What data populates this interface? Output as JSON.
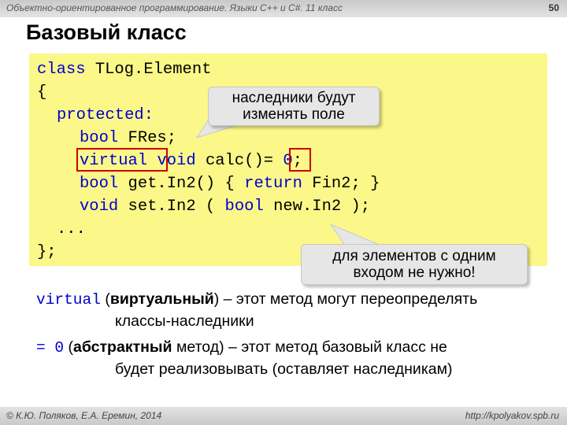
{
  "header": {
    "course_title": "Объектно-ориентированное программирование. Языки C++ и C#. 11 класс",
    "page_number": "50"
  },
  "slide": {
    "title": "Базовый класс"
  },
  "code": {
    "line1_kw": "class",
    "line1_rest": " TLog.Element",
    "line2": "{",
    "line3_kw": "protected:",
    "line4_kw": "bool",
    "line4_rest": " FRes;",
    "line5_kw1": "virtual",
    "line5_kw2": "void",
    "line5_mid": " calc()",
    "line5_eq": "= ",
    "line5_num": "0",
    "line5_end": ";",
    "line6_kw1": "bool",
    "line6_mid1": " get.In2() { ",
    "line6_kw2": "return",
    "line6_mid2": " Fin2; }",
    "line7_kw1": "void",
    "line7_mid1": " set.In2 ( ",
    "line7_kw2": "bool",
    "line7_mid2": " new.In2 );",
    "line8": "...",
    "line9": "};"
  },
  "callouts": {
    "top_line1": "наследники будут",
    "top_line2": "изменять поле",
    "bottom_line1": "для элементов с одним",
    "bottom_line2": "входом не нужно!"
  },
  "explanations": {
    "virtual_kw": "virtual",
    "virtual_open": " (",
    "virtual_term": "виртуальный",
    "virtual_rest": ") – этот метод могут переопределять",
    "virtual_line2": "классы-наследники",
    "abstract_kw": "= 0",
    "abstract_open": "  (",
    "abstract_term": "абстрактный",
    "abstract_rest": " метод) – этот метод базовый класс не",
    "abstract_line2": "будет реализовывать (оставляет наследникам)"
  },
  "footer": {
    "authors": "© К.Ю. Поляков, Е.А. Еремин, 2014",
    "url": "http://kpolyakov.spb.ru"
  },
  "colors": {
    "keyword": "#0000cc",
    "code_background": "#fbf889",
    "highlight_frame": "#cc0000",
    "callout_background": "#e6e6e6"
  }
}
